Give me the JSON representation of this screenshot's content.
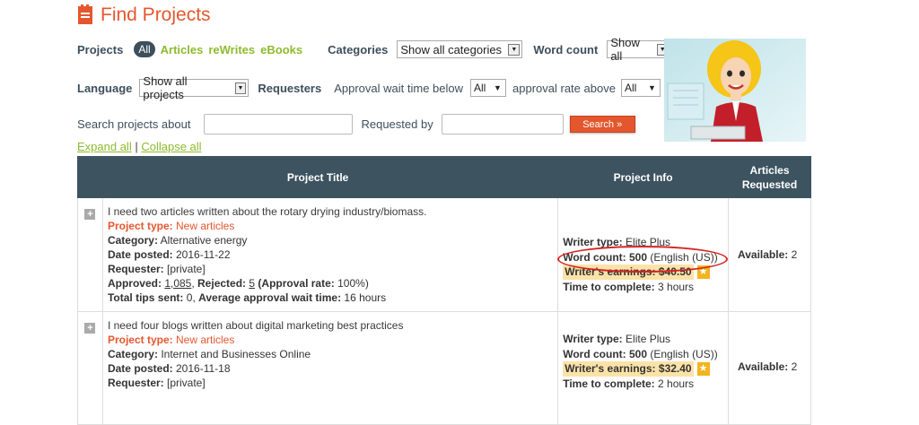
{
  "header": {
    "title": "Find Projects"
  },
  "filters": {
    "projects_label": "Projects",
    "types": [
      "All",
      "Articles",
      "reWrites",
      "eBooks"
    ],
    "categories_label": "Categories",
    "categories_value": "Show all categories",
    "word_count_label": "Word count",
    "word_count_value": "Show all",
    "language_label": "Language",
    "language_value": "Show all projects",
    "requesters_label": "Requesters",
    "approval_wait_label": "Approval wait time below",
    "approval_wait_value": "All",
    "approval_rate_label": "approval rate above",
    "approval_rate_value": "All"
  },
  "search": {
    "about_label": "Search projects about",
    "requested_by_label": "Requested by",
    "button_label": "Search »"
  },
  "expand": {
    "expand_all": "Expand all",
    "separator": "|",
    "collapse_all": "Collapse all"
  },
  "table": {
    "headers": {
      "title": "Project Title",
      "info": "Project Info",
      "requested": "Articles Requested"
    },
    "rows": [
      {
        "title": "I need two articles written about the rotary drying industry/biomass.",
        "project_type_label": "Project type:",
        "project_type": "New articles",
        "category_label": "Category:",
        "category": "Alternative energy",
        "date_label": "Date posted:",
        "date": "2016-11-22",
        "requester_label": "Requester:",
        "requester": "[private]",
        "approved_label": "Approved:",
        "approved": "1,085",
        "rejected_label": "Rejected:",
        "rejected": "5",
        "approval_rate_label": "(Approval rate:",
        "approval_rate": "100%)",
        "tips_label": "Total tips sent:",
        "tips": "0,",
        "wait_label": "Average approval wait time:",
        "wait": "16 hours",
        "writer_type_label": "Writer type:",
        "writer_type": "Elite Plus",
        "word_count_label": "Word count:",
        "word_count": "500",
        "word_count_lang": "(English (US))",
        "earnings_label": "Writer's earnings:",
        "earnings": "$40.50",
        "time_label": "Time to complete:",
        "time": "3 hours",
        "available_label": "Available:",
        "available": "2"
      },
      {
        "title": "I need four blogs written about digital marketing best practices",
        "project_type_label": "Project type:",
        "project_type": "New articles",
        "category_label": "Category:",
        "category": "Internet and Businesses Online",
        "date_label": "Date posted:",
        "date": "2016-11-18",
        "requester_label": "Requester:",
        "requester": "[private]",
        "writer_type_label": "Writer type:",
        "writer_type": "Elite Plus",
        "word_count_label": "Word count:",
        "word_count": "500",
        "word_count_lang": "(English (US))",
        "earnings_label": "Writer's earnings:",
        "earnings": "$32.40",
        "time_label": "Time to complete:",
        "time": "2 hours",
        "available_label": "Available:",
        "available": "2"
      }
    ]
  },
  "colors": {
    "accent": "#e4572e",
    "green": "#8dbb2e",
    "header_bg": "#3d5360",
    "annotation": "#d42222"
  }
}
